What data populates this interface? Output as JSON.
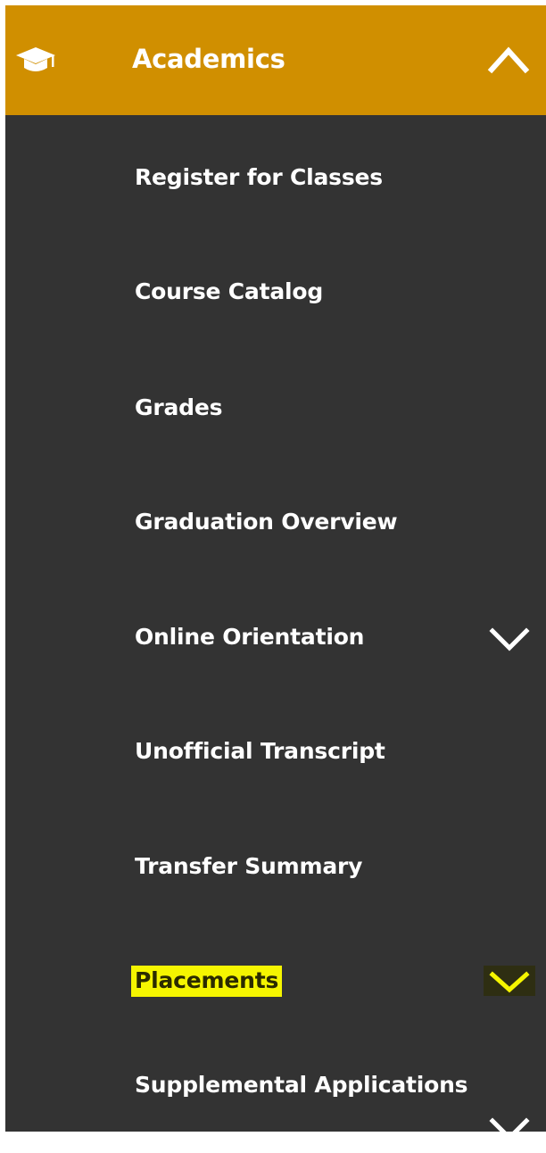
{
  "section": {
    "title": "Academics",
    "icon": "graduation-cap-icon",
    "toggle_icon": "chevron-up-icon",
    "accent_color": "#d08f00",
    "background_color": "#333333",
    "highlight_color": "#f5f500"
  },
  "items": [
    {
      "label": "Register for Classes",
      "has_submenu": false
    },
    {
      "label": "Course Catalog",
      "has_submenu": false
    },
    {
      "label": "Grades",
      "has_submenu": false
    },
    {
      "label": "Graduation Overview",
      "has_submenu": false
    },
    {
      "label": "Online Orientation",
      "has_submenu": true,
      "icon": "chevron-down-icon"
    },
    {
      "label": "Unofficial Transcript",
      "has_submenu": false
    },
    {
      "label": "Transfer Summary",
      "has_submenu": false
    },
    {
      "label": "Placements",
      "has_submenu": true,
      "icon": "chevron-down-icon",
      "highlighted": true
    },
    {
      "label": "Supplemental Applications",
      "has_submenu": true,
      "icon": "chevron-down-icon"
    }
  ]
}
